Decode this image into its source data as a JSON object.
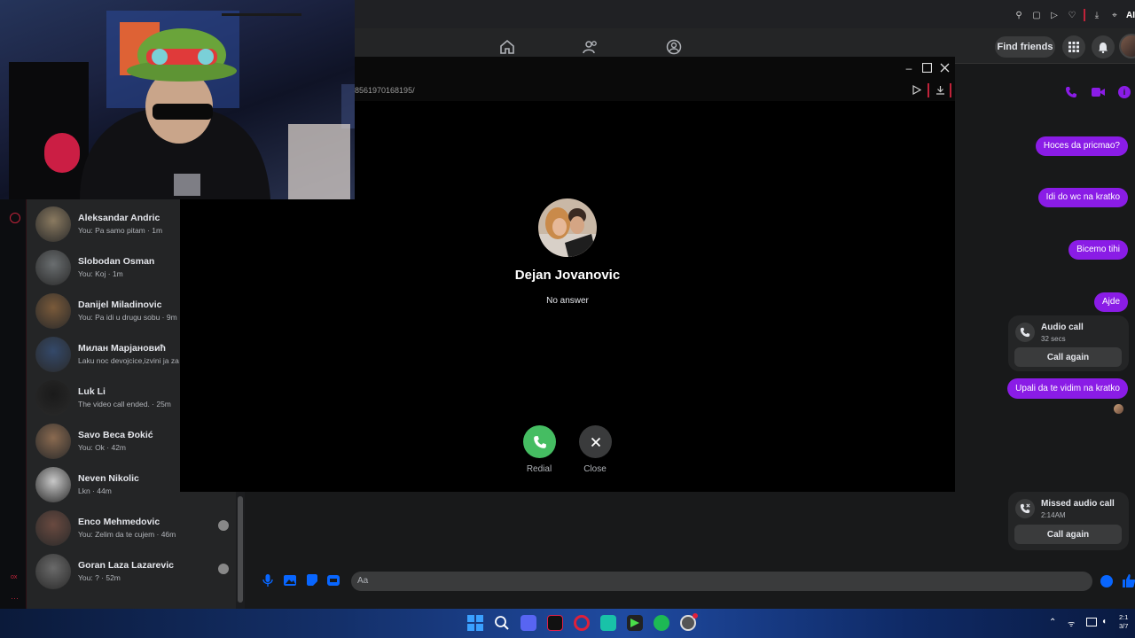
{
  "colors": {
    "accent": "#8a1ce6",
    "bg": "#18191a",
    "card": "#242526",
    "redial_green": "#45bd62",
    "messenger_blue": "#0866ff"
  },
  "browser": {
    "icons": [
      "pin-icon",
      "window-icon",
      "play-icon",
      "heart-icon",
      "download-icon",
      "tag-icon"
    ],
    "ai_label": "AI"
  },
  "header": {
    "nav_icons": [
      "home-icon",
      "friends-icon",
      "groups-icon"
    ],
    "find_friends_label": "Find friends",
    "icons": [
      "apps-grid-icon",
      "bell-icon"
    ]
  },
  "call": {
    "url": "8561970168195/",
    "caller_name": "Dejan Jovanovic",
    "status": "No answer",
    "redial_label": "Redial",
    "close_label": "Close"
  },
  "chats": [
    {
      "name": "Aleksandar Andric",
      "preview": "You: Pa samo pitam · 1m",
      "avatar_color": "#8a7a60",
      "read_avatar": false
    },
    {
      "name": "Slobodan Osman",
      "preview": "You: Koj · 1m",
      "avatar_color": "#6a6e70",
      "read_avatar": false
    },
    {
      "name": "Danijel Miladinovic",
      "preview": "You: Pa idi u drugu sobu · 9m",
      "avatar_color": "#7a5a3a",
      "read_avatar": false
    },
    {
      "name": "Милан Марјановић",
      "preview": "Laku noc devojcice,izvini ja za",
      "avatar_color": "#34496a",
      "read_avatar": false
    },
    {
      "name": "Luk Li",
      "preview": "The video call ended. · 25m",
      "avatar_color": "#1a1a1a",
      "read_avatar": false
    },
    {
      "name": "Savo Beca Đokić",
      "preview": "You: Ok · 42m",
      "avatar_color": "#8a6a50",
      "read_avatar": false
    },
    {
      "name": "Neven Nikolic",
      "preview": "Lkn · 44m",
      "avatar_color": "#c8c8c8",
      "read_avatar": false
    },
    {
      "name": "Enco Mehmedovic",
      "preview": "You: Zelim da te cujem · 46m",
      "avatar_color": "#6a4a40",
      "read_avatar": true
    },
    {
      "name": "Goran Laza Lazarevic",
      "preview": "You: ? · 52m",
      "avatar_color": "#6a6a6a",
      "read_avatar": true
    }
  ],
  "conversation": {
    "header_icons": [
      "phone-icon",
      "video-icon",
      "info-icon"
    ],
    "messages": [
      {
        "text": "Hoces da pricmao?"
      },
      {
        "text": "Idi do wc na kratko"
      },
      {
        "text": "Bicemo tihi"
      },
      {
        "text": "Ajde"
      },
      {
        "text": "Upali da te vidim na kratko"
      }
    ],
    "audio_call_card": {
      "title": "Audio call",
      "sub": "32 secs",
      "button": "Call again"
    },
    "missed_call_card": {
      "title": "Missed audio call",
      "sub": "2:14AM",
      "button": "Call again"
    },
    "composer_placeholder": "Aa"
  },
  "taskbar": {
    "apps": [
      {
        "name": "start-icon",
        "color": "#3aa0ff"
      },
      {
        "name": "search-icon",
        "color": "transparent"
      },
      {
        "name": "discord-icon",
        "color": "#5865f2"
      },
      {
        "name": "tiktok-icon",
        "color": "#111"
      },
      {
        "name": "opera-icon",
        "color": "#e0203a"
      },
      {
        "name": "app-icon",
        "color": "#19c2a8"
      },
      {
        "name": "terminal-icon",
        "color": "#222"
      },
      {
        "name": "spotify-icon",
        "color": "#1db954"
      },
      {
        "name": "chrome-icon",
        "color": "#555"
      }
    ],
    "time": "2:1",
    "date": "3/7"
  }
}
